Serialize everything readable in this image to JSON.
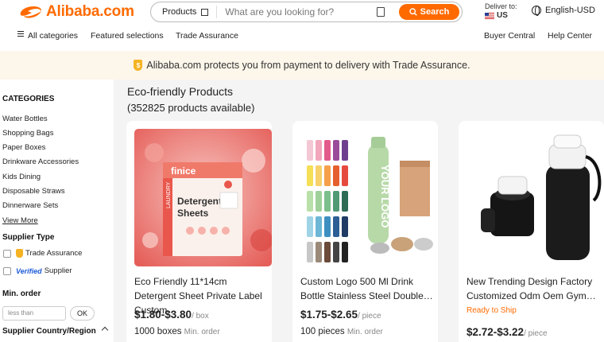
{
  "header": {
    "logo": "Alibaba.com",
    "search_category": "Products",
    "search_placeholder": "What are you looking for?",
    "search_button": "Search",
    "deliver_label": "Deliver to:",
    "deliver_country": "US",
    "language": "English-USD"
  },
  "nav": {
    "all_categories": "All categories",
    "featured": "Featured selections",
    "trade_assurance": "Trade Assurance",
    "buyer_central": "Buyer Central",
    "help_center": "Help Center"
  },
  "banner": {
    "text": "Alibaba.com protects you from payment to delivery with Trade Assurance."
  },
  "sidebar": {
    "categories_title": "CATEGORIES",
    "categories": [
      "Water Bottles",
      "Shopping Bags",
      "Paper Boxes",
      "Drinkware Accessories",
      "Kids Dining",
      "Disposable Straws",
      "Dinnerware Sets"
    ],
    "view_more": "View More",
    "supplier_type_title": "Supplier Type",
    "trade_assurance": "Trade Assurance",
    "verified_logo": "Verified",
    "supplier": "Supplier",
    "min_order_title": "Min. order",
    "min_order_placeholder": "less than",
    "ok_button": "OK",
    "country_title": "Supplier Country/Region"
  },
  "main": {
    "title": "Eco-friendly Products",
    "count": "(352825 products available)"
  },
  "products": [
    {
      "name": "Eco Friendly 11*14cm Detergent Sheet Private Label Custom…",
      "price": "$1.80-$3.80",
      "unit": "/ box",
      "moq": "1000 boxes",
      "moq_label": "Min. order",
      "image_brand": "finice",
      "image_title1": "Detergent",
      "image_title2": "Sheets",
      "image_side": "LAUNDRY"
    },
    {
      "name": "Custom Logo 500 Ml Drink Bottle Stainless Steel Double…",
      "price": "$1.75-$2.65",
      "unit": "/ piece",
      "moq": "100 pieces",
      "moq_label": "Min. order",
      "image_logo": "YOUR LOGO"
    },
    {
      "name": "New Trending Design Factory Customized Odm Oem Gym…",
      "price": "$2.72-$3.22",
      "unit": "/ piece",
      "badge": "Ready to Ship"
    }
  ],
  "colors": {
    "accent": "#ff6a00",
    "banner_bg": "#fdf6ea",
    "main_bg": "#f4f4f4"
  }
}
